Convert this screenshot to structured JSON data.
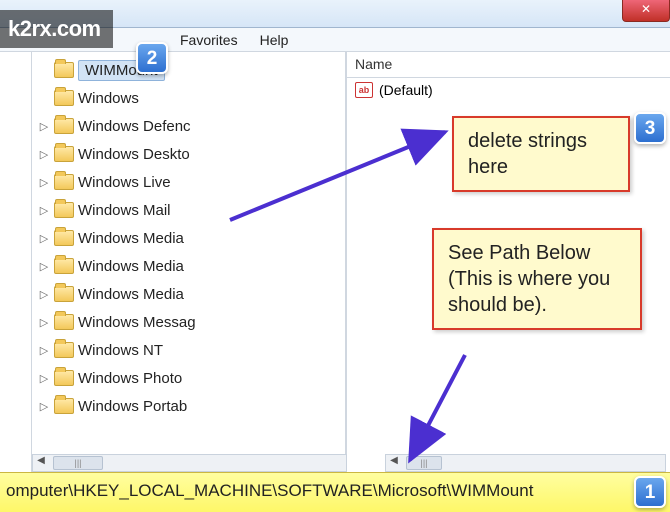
{
  "watermark": "k2rx.com",
  "menu": {
    "favorites": "Favorites",
    "help": "Help"
  },
  "close_glyph": "✕",
  "tree": {
    "items": [
      {
        "label": "WIMMount",
        "expandable": false,
        "selected": true
      },
      {
        "label": "Windows",
        "expandable": false,
        "selected": false
      },
      {
        "label": "Windows Defenc",
        "expandable": true,
        "selected": false
      },
      {
        "label": "Windows Deskto",
        "expandable": true,
        "selected": false
      },
      {
        "label": "Windows Live",
        "expandable": true,
        "selected": false
      },
      {
        "label": "Windows Mail",
        "expandable": true,
        "selected": false
      },
      {
        "label": "Windows Media",
        "expandable": true,
        "selected": false
      },
      {
        "label": "Windows Media",
        "expandable": true,
        "selected": false
      },
      {
        "label": "Windows Media",
        "expandable": true,
        "selected": false
      },
      {
        "label": "Windows Messag",
        "expandable": true,
        "selected": false
      },
      {
        "label": "Windows NT",
        "expandable": true,
        "selected": false
      },
      {
        "label": "Windows Photo",
        "expandable": true,
        "selected": false
      },
      {
        "label": "Windows Portab",
        "expandable": true,
        "selected": false
      }
    ]
  },
  "values": {
    "column_name": "Name",
    "default_label": "(Default)",
    "string_glyph": "ab"
  },
  "status_path": "omputer\\HKEY_LOCAL_MACHINE\\SOFTWARE\\Microsoft\\WIMMount",
  "markers": {
    "m1": "1",
    "m2": "2",
    "m3": "3"
  },
  "annotations": {
    "a1": "delete strings here",
    "a2": "See Path Below (This is where you should be)."
  },
  "scroll_thumb_glyph": "|||"
}
